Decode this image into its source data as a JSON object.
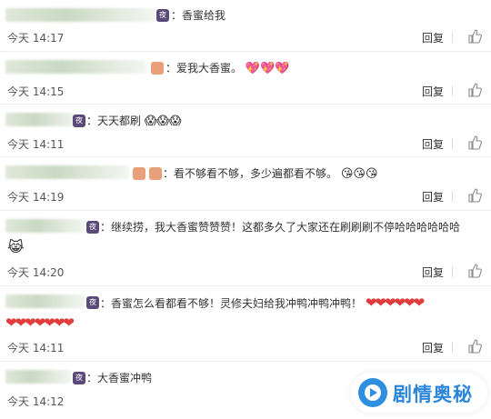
{
  "reply_label": "回复",
  "comments": [
    {
      "content": "：香蜜给我",
      "time": "今天 14:17"
    },
    {
      "content": "：爱我大香蜜。",
      "emoji": "💖💖💖",
      "time": "今天 14:15"
    },
    {
      "content": "：天天都刷",
      "emoji": "😱😱😱",
      "time": "今天 14:11"
    },
    {
      "content": "：看不够看不够，多少遍都看不够。",
      "emoji": "😘😘😘",
      "time": "今天 14:19"
    },
    {
      "content": "：继续捞，我大香蜜赞赞赞！这都多久了大家还在刷刷刷不停哈哈哈哈哈哈",
      "emoji": "😹",
      "time": "今天 14:20"
    },
    {
      "content": "：香蜜怎么看都看不够！灵修夫妇给我冲鸭冲鸭冲鸭！",
      "hearts1": "❤❤❤❤❤❤",
      "hearts2": "❤❤❤❤❤❤❤",
      "time": "今天 14:11"
    },
    {
      "content": "：大香蜜冲鸭",
      "time": "今天 14:12"
    }
  ],
  "watermark": {
    "text": "剧情奥秘"
  },
  "colors": {
    "heart": "#e23b3b",
    "watermark": "#2a86d8"
  }
}
